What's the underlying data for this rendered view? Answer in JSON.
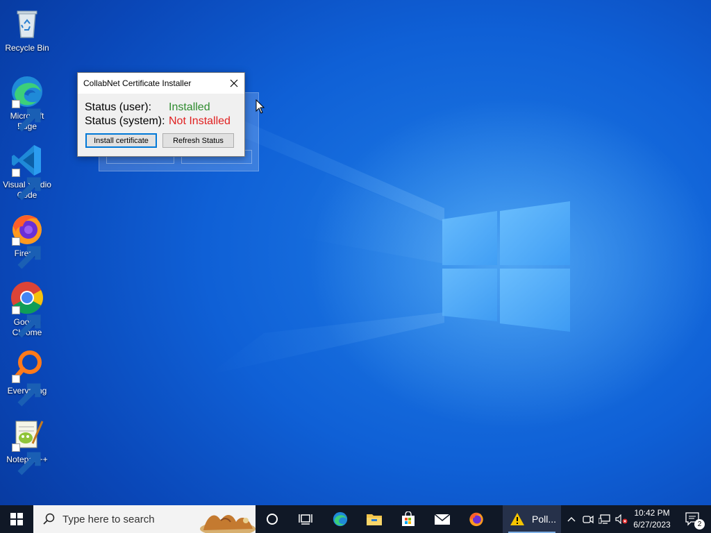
{
  "desktop": {
    "icons": [
      {
        "label": "Recycle Bin",
        "icon": "recycle-bin-icon",
        "shortcut": false
      },
      {
        "label": "Microsoft Edge",
        "icon": "edge-icon",
        "shortcut": true
      },
      {
        "label": "Visual Studio Code",
        "icon": "vscode-icon",
        "shortcut": true
      },
      {
        "label": "Firefox",
        "icon": "firefox-icon",
        "shortcut": true
      },
      {
        "label": "Google Chrome",
        "icon": "chrome-icon",
        "shortcut": true
      },
      {
        "label": "Everything",
        "icon": "everything-icon",
        "shortcut": true
      },
      {
        "label": "Notepad++",
        "icon": "notepadpp-icon",
        "shortcut": true
      }
    ],
    "icon_label_lines": {
      "edge": [
        "Microsoft",
        "Edge"
      ],
      "vscode": [
        "Visual Studio",
        "Code"
      ],
      "chrome": [
        "Google",
        "Chrome"
      ]
    }
  },
  "dialog": {
    "title": "CollabNet Certificate Installer",
    "user_label": "Status (user):",
    "user_value": "Installed",
    "system_label": "Status (system):",
    "system_value": "Not Installed",
    "install_button": "Install certificate",
    "refresh_button": "Refresh Status",
    "colors": {
      "installed": "#2e8b2e",
      "not_installed": "#e02020"
    }
  },
  "taskbar": {
    "search_placeholder": "Type here to search",
    "pinned": [
      "start-icon",
      "cortana-icon",
      "task-view-icon",
      "edge-icon",
      "file-explorer-icon",
      "store-icon",
      "mail-icon",
      "firefox-icon"
    ],
    "running_app_label": "Poll...",
    "running_app_icon": "warning-icon",
    "time": "10:42 PM",
    "date": "6/27/2023",
    "notification_count": "2"
  },
  "colors": {
    "accent": "#0078d7",
    "taskbar": "#101826"
  }
}
